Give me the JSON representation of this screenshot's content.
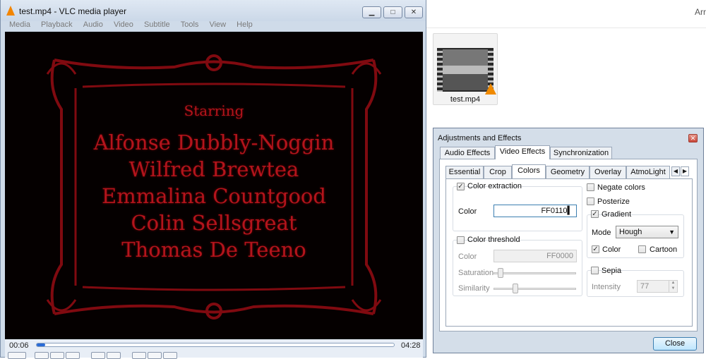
{
  "vlc": {
    "title": "test.mp4 - VLC media player",
    "menu": [
      "Media",
      "Playback",
      "Audio",
      "Video",
      "Subtitle",
      "Tools",
      "View",
      "Help"
    ],
    "credits": {
      "heading": "Starring",
      "names": [
        "Alfonse Dubbly-Noggin",
        "Wilfred Brewtea",
        "Emmalina Countgood",
        "Colin Sellsgreat",
        "Thomas De Teeno"
      ]
    },
    "time_elapsed": "00:06",
    "time_total": "04:28",
    "progress_fraction": 0.023
  },
  "desktop": {
    "corner_text": "Arr",
    "file_name": "test.mp4"
  },
  "dialog": {
    "title": "Adjustments and Effects",
    "tabs": [
      "Audio Effects",
      "Video Effects",
      "Synchronization"
    ],
    "active_tab": "Video Effects",
    "subtabs": [
      "Essential",
      "Crop",
      "Colors",
      "Geometry",
      "Overlay",
      "AtmoLight"
    ],
    "active_subtab": "Colors",
    "color_extraction": {
      "label": "Color extraction",
      "checked": true,
      "color_label": "Color",
      "color_value": "FF0110"
    },
    "color_threshold": {
      "label": "Color threshold",
      "checked": false,
      "color_label": "Color",
      "color_value": "FF0000",
      "saturation_label": "Saturation",
      "similarity_label": "Similarity"
    },
    "negate_colors": {
      "label": "Negate colors",
      "checked": false
    },
    "posterize": {
      "label": "Posterize",
      "checked": false
    },
    "gradient": {
      "label": "Gradient",
      "checked": true,
      "mode_label": "Mode",
      "mode_value": "Hough",
      "color_label": "Color",
      "color_checked": true,
      "cartoon_label": "Cartoon",
      "cartoon_checked": false
    },
    "sepia": {
      "label": "Sepia",
      "checked": false,
      "intensity_label": "Intensity",
      "intensity_value": "77"
    },
    "close_label": "Close"
  }
}
